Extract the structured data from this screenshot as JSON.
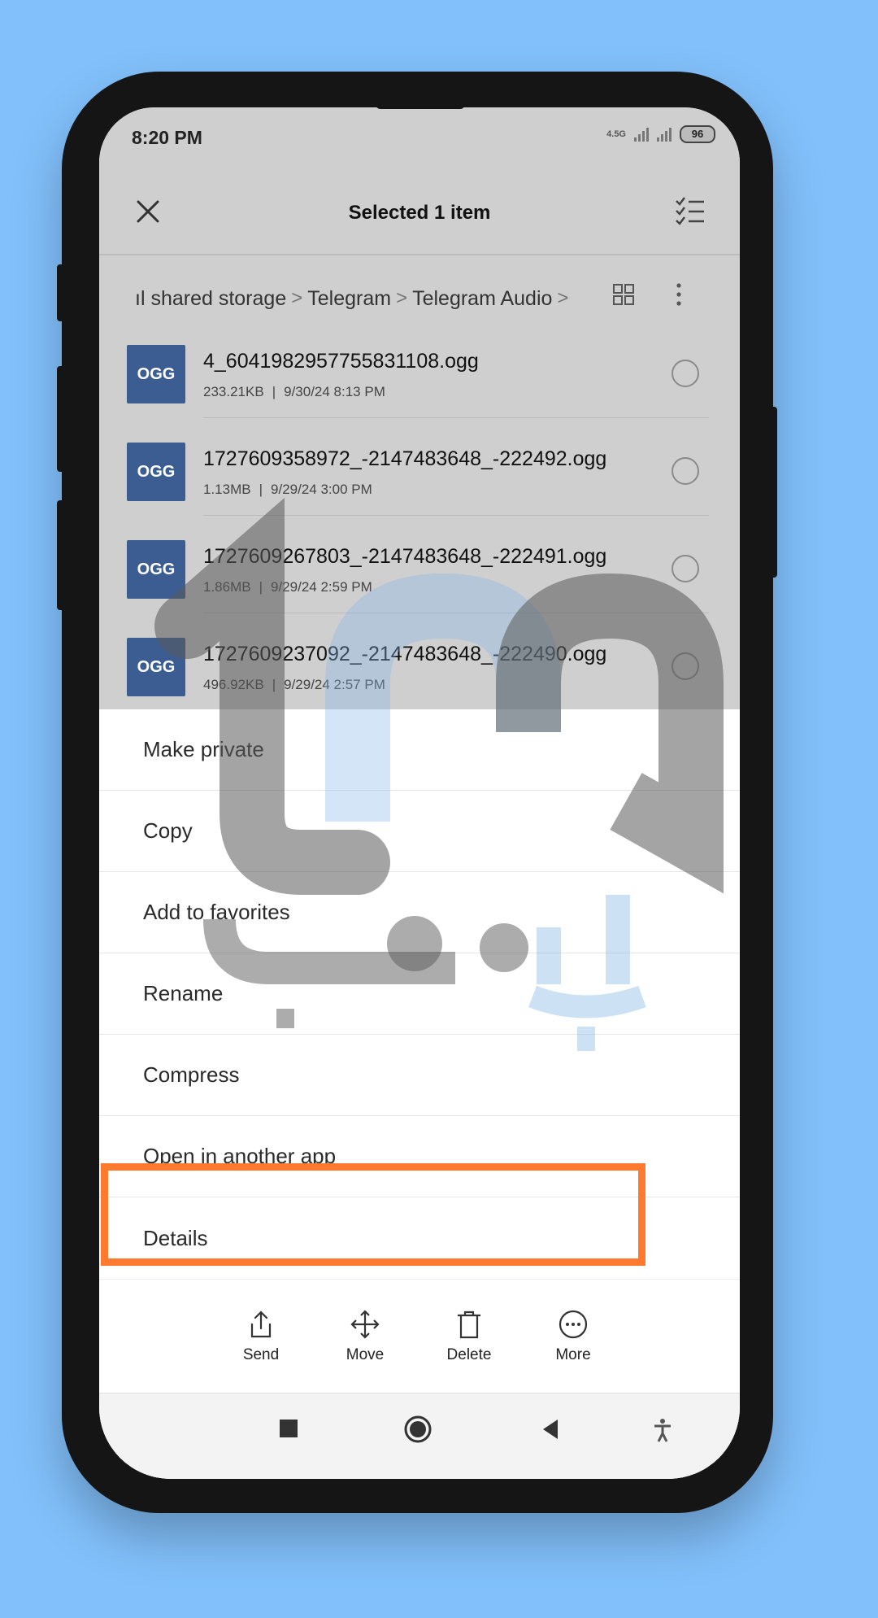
{
  "status_bar": {
    "time": "8:20 PM",
    "network": "4.5G",
    "battery": "96"
  },
  "header": {
    "title": "Selected 1 item",
    "close_icon": "close-icon",
    "select_all_icon": "checklist-icon"
  },
  "breadcrumb": {
    "items": [
      "ıl shared storage",
      "Telegram",
      "Telegram Audio"
    ],
    "separator": ">"
  },
  "files": [
    {
      "name": "4_6041982957755831108.ogg",
      "size": "233.21KB",
      "date": "9/30/24 8:13 PM",
      "type": "OGG"
    },
    {
      "name": "1727609358972_-2147483648_-222492.ogg",
      "size": "1.13MB",
      "date": "9/29/24 3:00 PM",
      "type": "OGG"
    },
    {
      "name": "1727609267803_-2147483648_-222491.ogg",
      "size": "1.86MB",
      "date": "9/29/24 2:59 PM",
      "type": "OGG"
    },
    {
      "name": "1727609237092_-2147483648_-222490.ogg",
      "size": "496.92KB",
      "date": "9/29/24 2:57 PM",
      "type": "OGG"
    }
  ],
  "menu": {
    "items": [
      "Make private",
      "Copy",
      "Add to favorites",
      "Rename",
      "Compress",
      "Open in another app",
      "Details"
    ],
    "highlighted": "Open in another app",
    "highlight_color": "#ff7a2f"
  },
  "actions": [
    {
      "label": "Send",
      "icon": "share-icon"
    },
    {
      "label": "Move",
      "icon": "move-icon"
    },
    {
      "label": "Delete",
      "icon": "trash-icon"
    },
    {
      "label": "More",
      "icon": "more-icon"
    }
  ],
  "colors": {
    "background": "#82c0fb",
    "file_icon": "#3b5d92",
    "highlight": "#ff7a2f"
  }
}
